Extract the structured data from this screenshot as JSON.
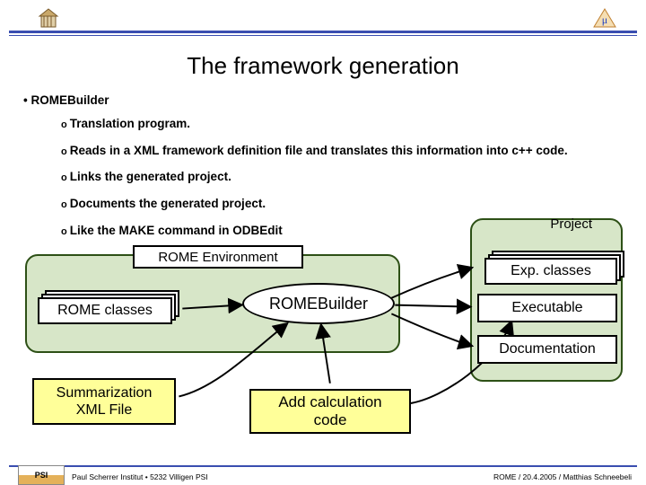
{
  "title": "The framework generation",
  "bullets": {
    "main": "ROMEBuilder",
    "subs": [
      "Translation program.",
      "Reads in a XML framework definition file and translates this information into c++ code.",
      "Links the generated project.",
      "Documents the generated project.",
      "Like the MAKE command in ODBEdit"
    ]
  },
  "diagram": {
    "env_label": "ROME Environment",
    "project_label": "Project",
    "rome_classes": "ROME classes",
    "exp_classes": "Exp. classes",
    "builder": "ROMEBuilder",
    "executable": "Executable",
    "documentation": "Documentation",
    "xml_file": "Summarization\nXML File",
    "add_calc": "Add calculation\ncode"
  },
  "footer": {
    "left": "Paul Scherrer Institut • 5232 Villigen PSI",
    "right": "ROME / 20.4.2005 / Matthias Schneebeli",
    "psi": "PSI"
  }
}
